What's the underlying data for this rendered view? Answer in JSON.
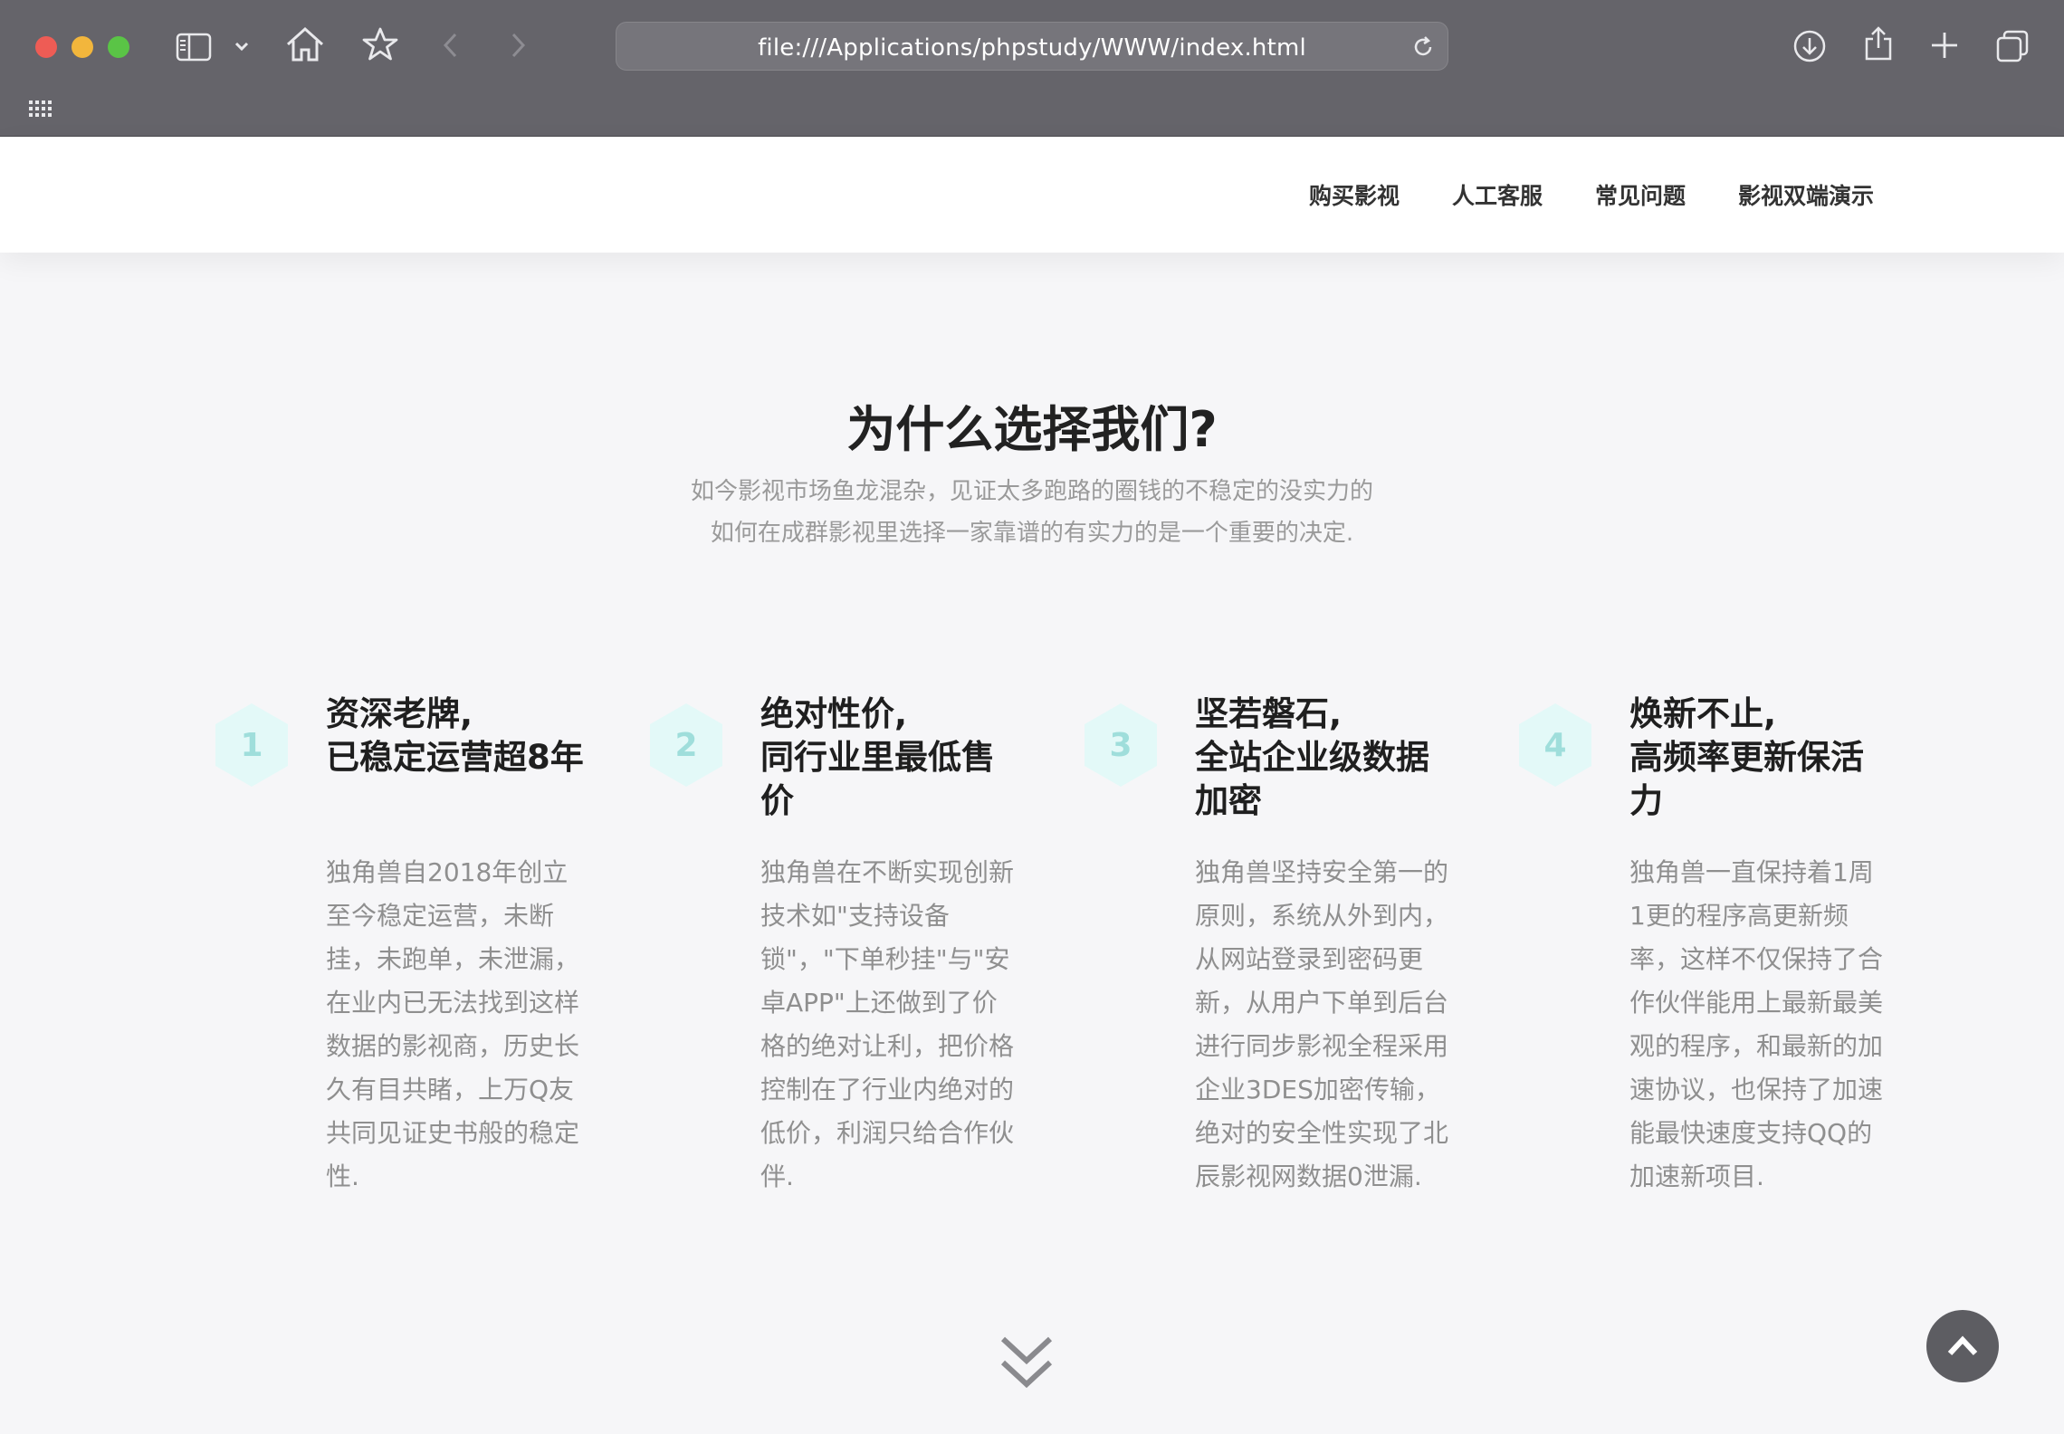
{
  "browser": {
    "url": "file:///Applications/phpstudy/WWW/index.html"
  },
  "nav": {
    "items": [
      "购买影视",
      "人工客服",
      "常见问题",
      "影视双端演示"
    ]
  },
  "section": {
    "title": "为什么选择我们?",
    "subtitle_line1": "如今影视市场鱼龙混杂，见证太多跑路的圈钱的不稳定的没实力的",
    "subtitle_line2": "如何在成群影视里选择一家靠谱的有实力的是一个重要的决定."
  },
  "features": [
    {
      "num": "1",
      "title_line1": "资深老牌,",
      "title_line2": "已稳定运营超8年",
      "desc": "独角兽自2018年创立至今稳定运营，未断挂，未跑单，未泄漏，在业内已无法找到这样数据的影视商，历史长久有目共睹，上万Q友共同见证史书般的稳定性."
    },
    {
      "num": "2",
      "title_line1": "绝对性价,",
      "title_line2": "同行业里最低售价",
      "desc": "独角兽在不断实现创新技术如\"支持设备锁\"，\"下单秒挂\"与\"安卓APP\"上还做到了价格的绝对让利，把价格控制在了行业内绝对的低价，利润只给合作伙伴."
    },
    {
      "num": "3",
      "title_line1": "坚若磐石,",
      "title_line2": "全站企业级数据加密",
      "desc": "独角兽坚持安全第一的原则，系统从外到内，从网站登录到密码更新，从用户下单到后台进行同步影视全程采用企业3DES加密传输，绝对的安全性实现了北辰影视网数据0泄漏."
    },
    {
      "num": "4",
      "title_line1": "焕新不止,",
      "title_line2": "高频率更新保活力",
      "desc": "独角兽一直保持着1周1更的程序高更新频率，这样不仅保持了合作伙伴能用上最新最美观的程序，和最新的加速协议，也保持了加速能最快速度支持QQ的加速新项目."
    }
  ],
  "colors": {
    "accent_hex": "#e3f9f8",
    "hex_number": "#9fdedb",
    "background": "#f6f6f8"
  },
  "icons": [
    "sidebar-icon",
    "chevron-down-icon",
    "home-icon",
    "star-icon",
    "back-icon",
    "forward-icon",
    "reload-icon",
    "download-icon",
    "share-icon",
    "new-tab-icon",
    "tabs-overview-icon",
    "grid-icon",
    "double-chevron-down-icon",
    "back-to-top-icon"
  ]
}
